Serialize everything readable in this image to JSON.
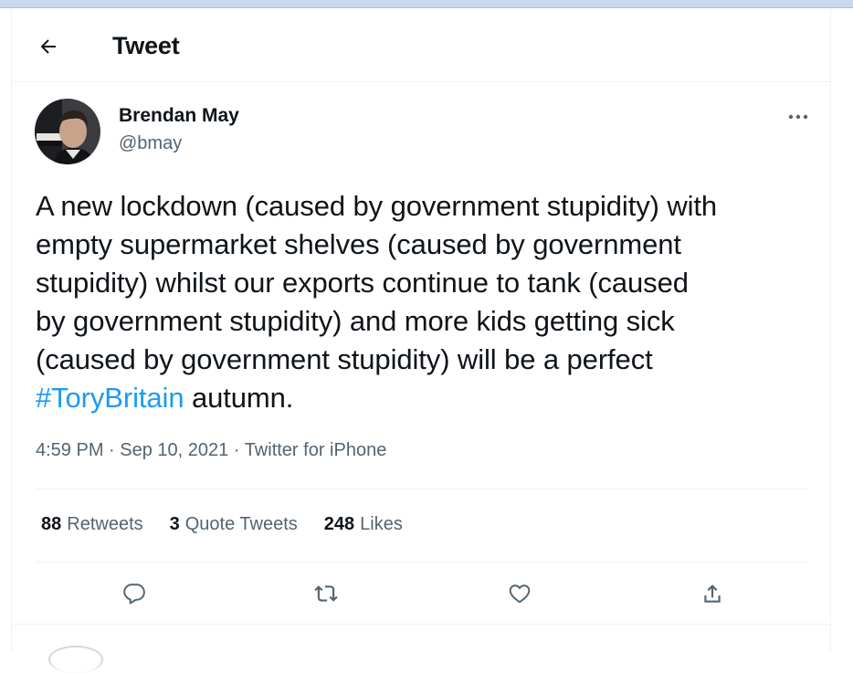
{
  "header": {
    "title": "Tweet"
  },
  "author": {
    "name": "Brendan May",
    "handle": "@bmay"
  },
  "tweet": {
    "text_before": "A new lockdown (caused by government stupidity) with\nempty supermarket shelves (caused by government\nstupidity) whilst our exports continue to tank (caused\nby government stupidity) and more kids getting sick\n(caused by government stupidity) will be a perfect\n",
    "hashtag": "#ToryBritain",
    "text_after": " autumn."
  },
  "meta": {
    "time": "4:59 PM",
    "separator1": " · ",
    "date": "Sep 10, 2021",
    "separator2": " · ",
    "source": "Twitter for iPhone"
  },
  "stats": {
    "retweets_count": "88",
    "retweets_label": "Retweets",
    "quotes_count": "3",
    "quotes_label": "Quote Tweets",
    "likes_count": "248",
    "likes_label": "Likes"
  },
  "icons": {
    "back": "arrow-left-icon",
    "more": "more-horizontal-icon",
    "reply": "reply-icon",
    "retweet": "retweet-icon",
    "like": "heart-icon",
    "share": "share-icon"
  },
  "colors": {
    "accent": "#1d9bf0",
    "secondary_text": "#536471",
    "divider": "#eff3f4"
  }
}
